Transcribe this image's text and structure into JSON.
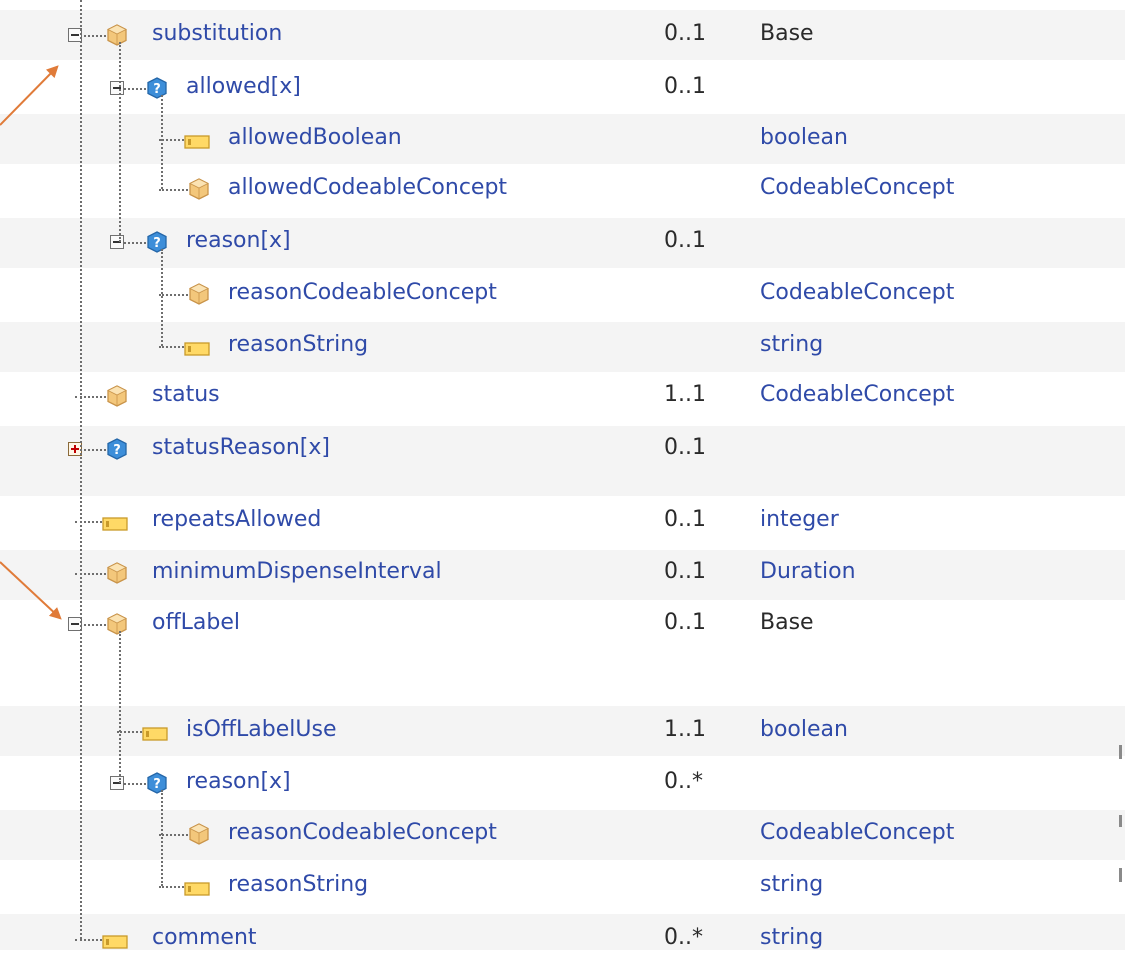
{
  "tree": {
    "rows": [
      {
        "name": "substitution",
        "card": "0..1",
        "type": "Base",
        "type_link": false,
        "icon": "complex-type-icon",
        "depth": 1,
        "toggle": "collapse"
      },
      {
        "name": "allowed[x]",
        "card": "0..1",
        "type": "",
        "type_link": false,
        "icon": "choice-type-icon",
        "depth": 2,
        "toggle": "collapse"
      },
      {
        "name": "allowedBoolean",
        "card": "",
        "type": "boolean",
        "type_link": true,
        "icon": "primitive-type-icon",
        "depth": 3,
        "toggle": "none"
      },
      {
        "name": "allowedCodeableConcept",
        "card": "",
        "type": "CodeableConcept",
        "type_link": true,
        "icon": "complex-type-icon",
        "depth": 3,
        "toggle": "none"
      },
      {
        "name": "reason[x]",
        "card": "0..1",
        "type": "",
        "type_link": false,
        "icon": "choice-type-icon",
        "depth": 2,
        "toggle": "collapse"
      },
      {
        "name": "reasonCodeableConcept",
        "card": "",
        "type": "CodeableConcept",
        "type_link": true,
        "icon": "complex-type-icon",
        "depth": 3,
        "toggle": "none"
      },
      {
        "name": "reasonString",
        "card": "",
        "type": "string",
        "type_link": true,
        "icon": "primitive-type-icon",
        "depth": 3,
        "toggle": "none"
      },
      {
        "name": "status",
        "card": "1..1",
        "type": "CodeableConcept",
        "type_link": true,
        "icon": "complex-type-icon",
        "depth": 1,
        "toggle": "none"
      },
      {
        "name": "statusReason[x]",
        "card": "0..1",
        "type": "",
        "type_link": false,
        "icon": "choice-type-icon",
        "depth": 1,
        "toggle": "expand"
      },
      {
        "name": "repeatsAllowed",
        "card": "0..1",
        "type": "integer",
        "type_link": true,
        "icon": "primitive-type-icon",
        "depth": 1,
        "toggle": "none"
      },
      {
        "name": "minimumDispenseInterval",
        "card": "0..1",
        "type": "Duration",
        "type_link": true,
        "icon": "complex-type-icon",
        "depth": 1,
        "toggle": "none"
      },
      {
        "name": "offLabel",
        "card": "0..1",
        "type": "Base",
        "type_link": false,
        "icon": "complex-type-icon",
        "depth": 1,
        "toggle": "collapse"
      },
      {
        "name": "isOffLabelUse",
        "card": "1..1",
        "type": "boolean",
        "type_link": true,
        "icon": "primitive-type-icon",
        "depth": 2,
        "toggle": "none"
      },
      {
        "name": "reason[x]",
        "card": "0..*",
        "type": "",
        "type_link": false,
        "icon": "choice-type-icon",
        "depth": 2,
        "toggle": "collapse"
      },
      {
        "name": "reasonCodeableConcept",
        "card": "",
        "type": "CodeableConcept",
        "type_link": true,
        "icon": "complex-type-icon",
        "depth": 3,
        "toggle": "none"
      },
      {
        "name": "reasonString",
        "card": "",
        "type": "string",
        "type_link": true,
        "icon": "primitive-type-icon",
        "depth": 3,
        "toggle": "none"
      },
      {
        "name": "comment",
        "card": "0..*",
        "type": "string",
        "type_link": true,
        "icon": "primitive-type-icon",
        "depth": 1,
        "toggle": "none"
      }
    ]
  },
  "annotations": {
    "arrow_color": "#e07b39"
  },
  "colors": {
    "link": "#2f4aa8",
    "row_alt": "#f4f4f4",
    "text": "#2a2a2a"
  }
}
